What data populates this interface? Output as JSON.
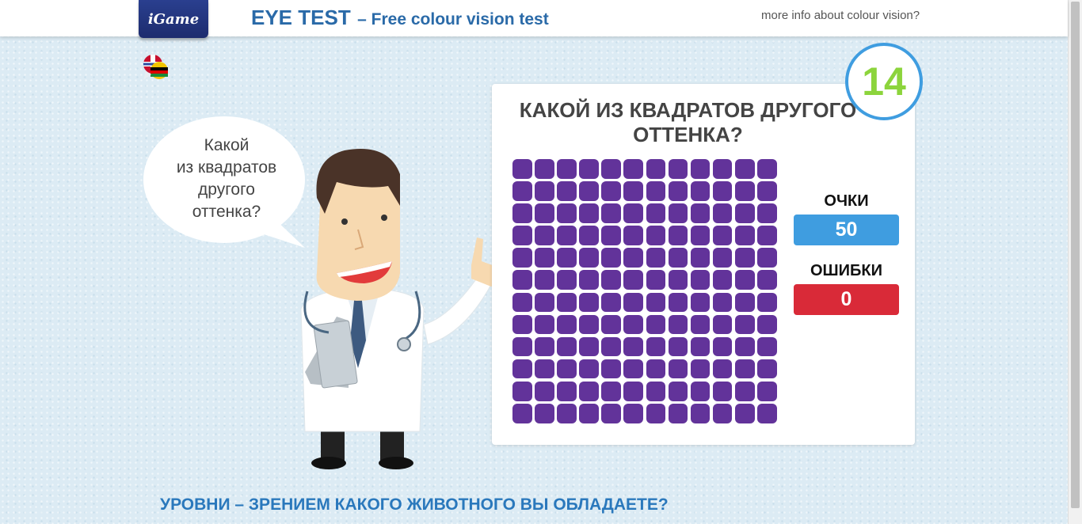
{
  "header": {
    "logo_text": "iGame",
    "title_main": "EYE TEST",
    "title_sub": "– Free colour vision test",
    "more_info_link": "more info about colour vision?"
  },
  "doctor": {
    "speech_lines": [
      "Какой",
      "из квадратов",
      "другого",
      "оттенка?"
    ]
  },
  "game": {
    "question": "КАКОЙ ИЗ КВАДРАТОВ ДРУГОГО ОТТЕНКА?",
    "grid_rows": 12,
    "grid_cols": 12,
    "tile_color": "#62339a",
    "score_label": "ОЧКИ",
    "score_value": "50",
    "errors_label": "ОШИБКИ",
    "errors_value": "0",
    "timer_value": "14"
  },
  "colors": {
    "accent_blue": "#3f9de0",
    "error_red": "#d92a38",
    "timer_green": "#8cd43c",
    "title_blue": "#2a6aa8"
  },
  "language_icon": "flags-speech-bubble-icon",
  "bottom_title": "УРОВНИ – ЗРЕНИЕМ КАКОГО ЖИВОТНОГО ВЫ ОБЛАДАЕТЕ?"
}
